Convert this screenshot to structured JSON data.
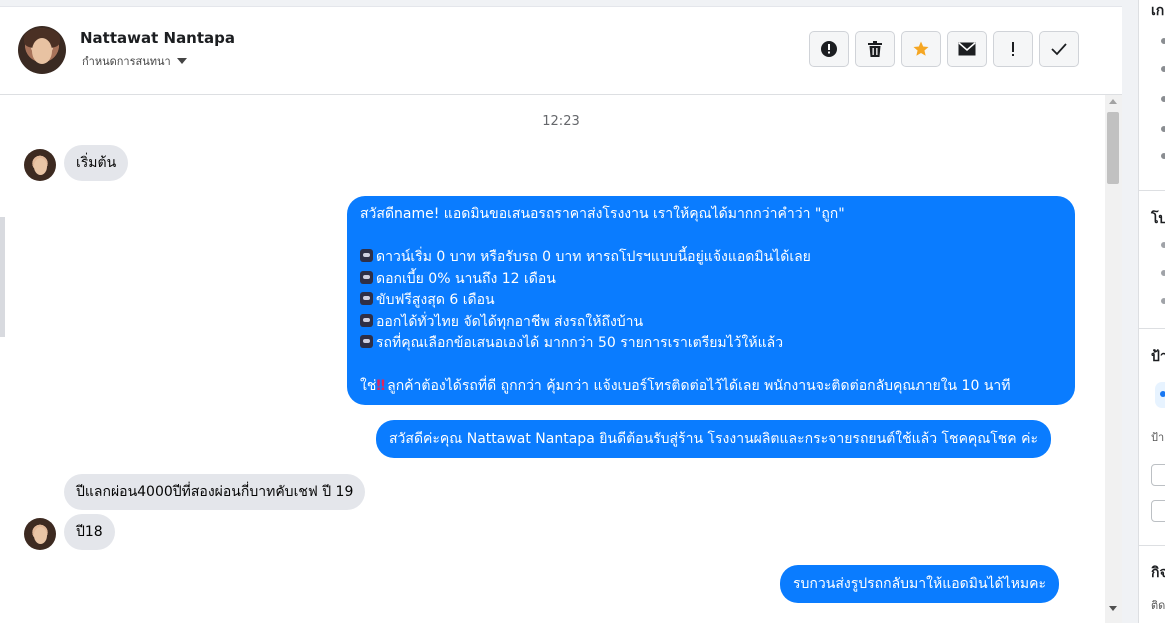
{
  "header": {
    "contact_name": "Nattawat Nantapa",
    "assign_label": "กำหนดการสนทนา",
    "actions": [
      "mark-spam",
      "delete",
      "star",
      "mark-unread",
      "follow-up",
      "mark-done"
    ]
  },
  "chat": {
    "timestamp": "12:23",
    "msg1": "เริ่มต้น",
    "msg2": {
      "line1": "สวัสดีname! แอดมินขอเสนอรถราคาส่งโรงงาน เราให้คุณได้มากกว่าคำว่า \"ถูก\"",
      "bullets": [
        "ดาวน์เริ่ม 0 บาท หรือรับรถ 0 บาท หารถโปรฯแบบนี้อยู่แจ้งแอดมินได้เลย",
        "ดอกเบี้ย 0% นานถึง 12 เดือน",
        "ขับฟรีสูงสุด 6 เดือน",
        "ออกได้ทั่วไทย จัดได้ทุกอาชีพ ส่งรถให้ถึงบ้าน",
        "รถที่คุณเลือกข้อเสนอเองได้ มากกว่า 50 รายการเราเตรียมไว้ให้แล้ว"
      ],
      "last_prefix": "ใช่",
      "last_rest": "ลูกค้าต้องได้รถที่ดี ถูกกว่า คุ้มกว่า แจ้งเบอร์โทรติดต่อไว้ได้เลย พนักงานจะติดต่อกลับคุณภายใน 10 นาที"
    },
    "msg3": "สวัสดีค่ะคุณ Nattawat Nantapa ยินดีต้อนรับสู่ร้าน โรงงานผลิตและกระจายรถยนต์ใช้แล้ว โชคคุณโชค ค่ะ",
    "msg4": "ปีแลกผ่อน4000ปีที่สองผ่อนกี่บาทคับเชฟ ปี 19",
    "msg5": "ปี18",
    "msg6": "รบกวนส่งรูปรถกลับมาให้แอดมินได้ไหมคะ"
  },
  "right_panel": {
    "section1": "เก",
    "section2": "โบ",
    "section3": "ป้า",
    "section3_sub": "ป้า",
    "section4": "กิจ",
    "section4_sub": "ติด"
  },
  "colors": {
    "outgoing": "#0a7cff",
    "incoming": "#e4e6eb",
    "star": "#f5a623"
  }
}
